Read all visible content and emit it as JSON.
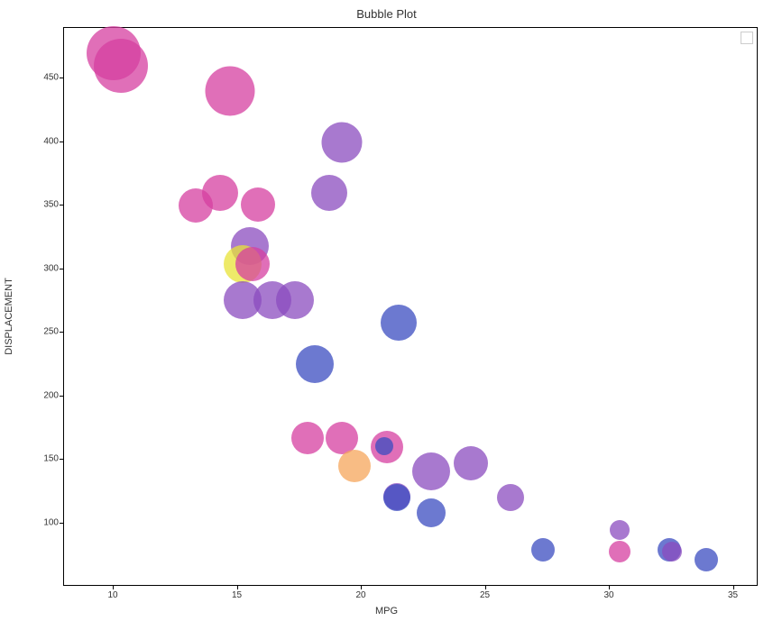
{
  "chart_data": {
    "type": "bubble",
    "title": "Bubble Plot",
    "xlabel": "MPG",
    "ylabel": "DISPLACEMENT",
    "xlim": [
      8,
      36
    ],
    "ylim": [
      50,
      490
    ],
    "x_ticks": [
      10,
      15,
      20,
      25,
      30,
      35
    ],
    "y_ticks": [
      100,
      150,
      200,
      250,
      300,
      350,
      400,
      450
    ],
    "colors": {
      "pink": "#d63fa0",
      "purple": "#8b4cbf",
      "blue": "#3b4cc0",
      "yellow": "#e8e337",
      "orange": "#f5a65b"
    },
    "points": [
      {
        "mpg": 10.0,
        "displacement": 470,
        "size": 60,
        "color": "pink"
      },
      {
        "mpg": 10.3,
        "displacement": 460,
        "size": 60,
        "color": "pink"
      },
      {
        "mpg": 14.7,
        "displacement": 440,
        "size": 55,
        "color": "pink"
      },
      {
        "mpg": 19.2,
        "displacement": 400,
        "size": 45,
        "color": "purple"
      },
      {
        "mpg": 14.3,
        "displacement": 360,
        "size": 40,
        "color": "pink"
      },
      {
        "mpg": 18.7,
        "displacement": 360,
        "size": 40,
        "color": "purple"
      },
      {
        "mpg": 13.3,
        "displacement": 350,
        "size": 38,
        "color": "pink"
      },
      {
        "mpg": 15.8,
        "displacement": 351,
        "size": 38,
        "color": "pink"
      },
      {
        "mpg": 15.5,
        "displacement": 318,
        "size": 42,
        "color": "purple"
      },
      {
        "mpg": 15.2,
        "displacement": 304,
        "size": 42,
        "color": "yellow"
      },
      {
        "mpg": 15.6,
        "displacement": 304,
        "size": 38,
        "color": "pink"
      },
      {
        "mpg": 15.2,
        "displacement": 276,
        "size": 42,
        "color": "purple"
      },
      {
        "mpg": 16.4,
        "displacement": 276,
        "size": 42,
        "color": "purple"
      },
      {
        "mpg": 17.3,
        "displacement": 276,
        "size": 42,
        "color": "purple"
      },
      {
        "mpg": 21.5,
        "displacement": 258,
        "size": 40,
        "color": "blue"
      },
      {
        "mpg": 18.1,
        "displacement": 225,
        "size": 42,
        "color": "blue"
      },
      {
        "mpg": 17.8,
        "displacement": 167,
        "size": 36,
        "color": "pink"
      },
      {
        "mpg": 19.2,
        "displacement": 167,
        "size": 36,
        "color": "pink"
      },
      {
        "mpg": 21.0,
        "displacement": 160,
        "size": 36,
        "color": "pink"
      },
      {
        "mpg": 20.9,
        "displacement": 161,
        "size": 20,
        "color": "blue"
      },
      {
        "mpg": 19.7,
        "displacement": 145,
        "size": 36,
        "color": "orange"
      },
      {
        "mpg": 24.4,
        "displacement": 147,
        "size": 38,
        "color": "purple"
      },
      {
        "mpg": 22.8,
        "displacement": 141,
        "size": 42,
        "color": "purple"
      },
      {
        "mpg": 21.4,
        "displacement": 121,
        "size": 30,
        "color": "purple"
      },
      {
        "mpg": 21.4,
        "displacement": 120,
        "size": 30,
        "color": "blue"
      },
      {
        "mpg": 22.8,
        "displacement": 108,
        "size": 32,
        "color": "blue"
      },
      {
        "mpg": 26.0,
        "displacement": 120,
        "size": 30,
        "color": "purple"
      },
      {
        "mpg": 30.4,
        "displacement": 95,
        "size": 22,
        "color": "purple"
      },
      {
        "mpg": 27.3,
        "displacement": 79,
        "size": 26,
        "color": "blue"
      },
      {
        "mpg": 30.4,
        "displacement": 78,
        "size": 24,
        "color": "pink"
      },
      {
        "mpg": 32.4,
        "displacement": 79,
        "size": 26,
        "color": "blue"
      },
      {
        "mpg": 33.9,
        "displacement": 71,
        "size": 26,
        "color": "blue"
      },
      {
        "mpg": 32.5,
        "displacement": 78,
        "size": 22,
        "color": "purple"
      }
    ]
  }
}
